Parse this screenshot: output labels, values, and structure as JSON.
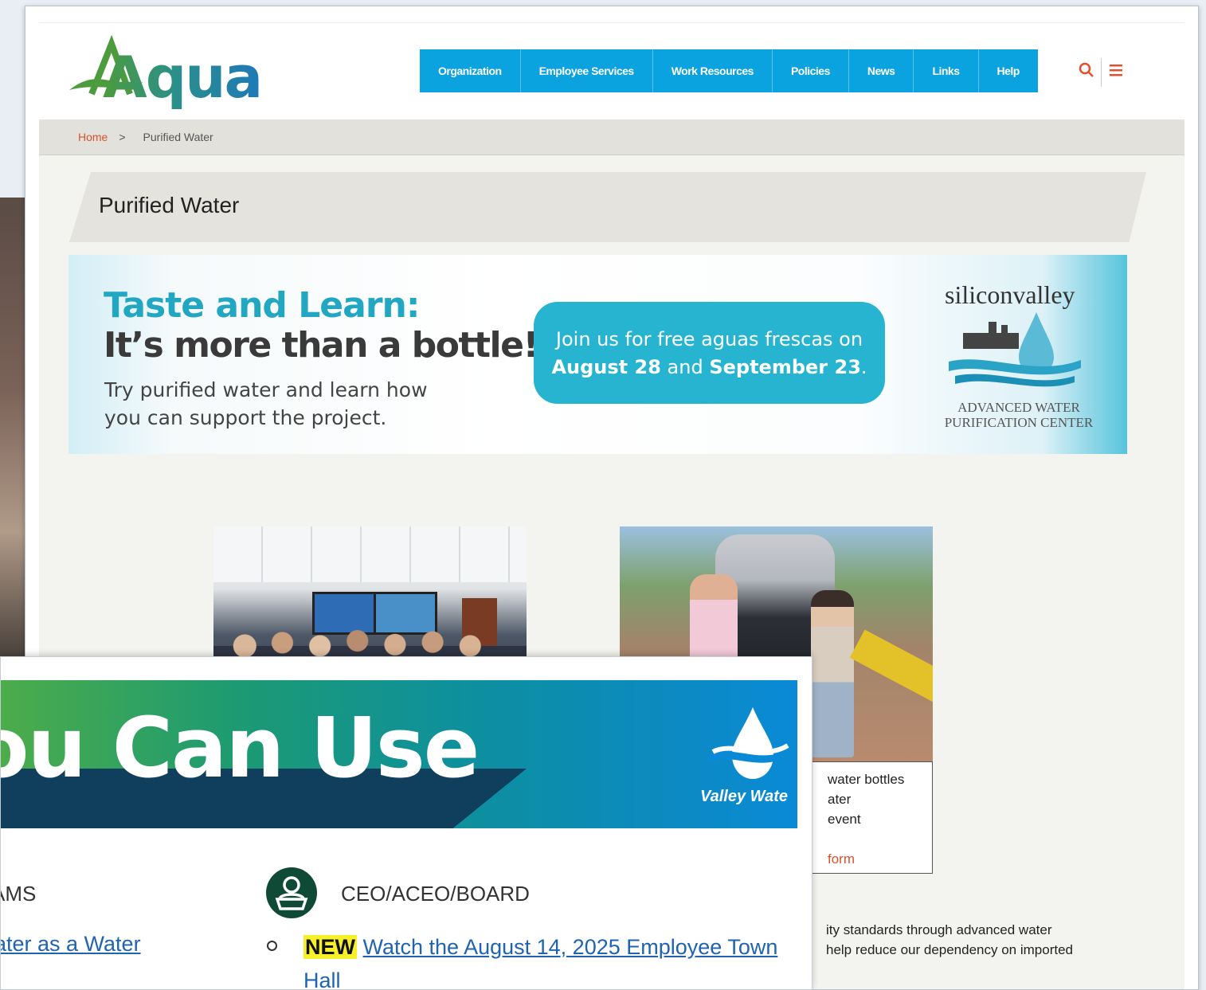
{
  "intranet": {
    "logo_text": "Aqua",
    "nav": [
      "Organization",
      "Employee Services",
      "Work Resources",
      "Policies",
      "News",
      "Links",
      "Help"
    ],
    "tools": {
      "search_icon": "search-icon",
      "menu_icon": "hamburger-menu-icon"
    },
    "breadcrumb": {
      "home": "Home",
      "separator": ">",
      "current": "Purified Water"
    },
    "page_title": "Purified Water",
    "banner": {
      "headline_1": "Taste and Learn:",
      "headline_2": "It’s more than a bottle!",
      "subtext": "Try purified water and learn how you can support the project.",
      "pill_line_1": "Join us for free aguas frescas on",
      "pill_date_1": "August 28",
      "pill_and": "and",
      "pill_date_2": "September 23",
      "pill_end": ".",
      "brand": "siliconvalley",
      "center_line_1": "ADVANCED WATER",
      "center_line_2": "PURIFICATION CENTER"
    },
    "caption": {
      "line_1": "water bottles",
      "line_2": "ater",
      "line_3": "event",
      "link": "form"
    },
    "body": {
      "line_1": "ity standards through advanced water",
      "line_2": "help reduce our dependency on imported"
    }
  },
  "newsletter": {
    "banner_title": "ou Can Use",
    "brand": "Valley Wate",
    "left_column": {
      "heading": "AMS",
      "link": "ater as a Water"
    },
    "ceo_column": {
      "heading": "CEO/ACEO/BOARD",
      "icon": "person-podium-icon",
      "item_badge": "NEW",
      "item_link": "Watch the August 14, 2025 Employee Town Hall"
    }
  },
  "colors": {
    "nav_blue": "#0aa2df",
    "accent_orange": "#d9512e",
    "banner_teal": "#27b4d1",
    "ceo_green": "#0f4a37",
    "link_blue": "#1f63b3",
    "new_yellow": "#f6f02a"
  }
}
